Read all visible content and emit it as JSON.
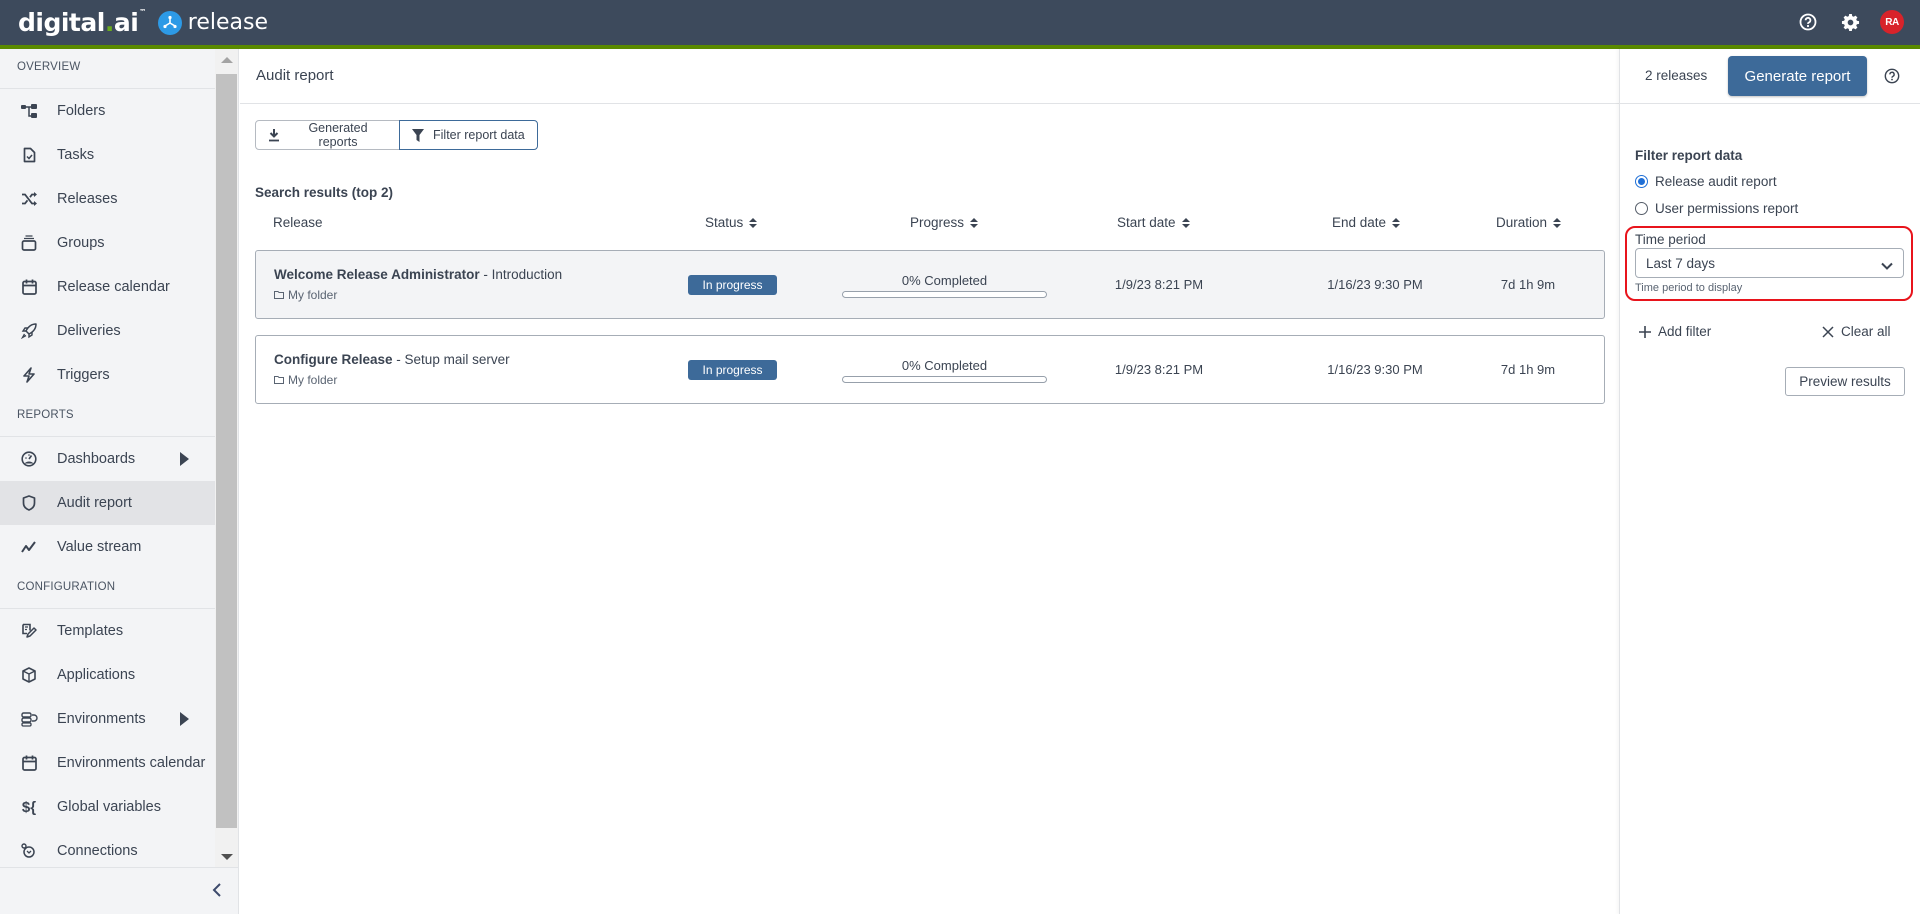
{
  "header": {
    "brand_primary": "digital",
    "brand_dot": ".",
    "brand_suffix": "ai",
    "product": "release",
    "avatar_initials": "RA",
    "icons": [
      "help-icon",
      "gear-icon"
    ],
    "colors": {
      "topbar": "#3d4a5c",
      "accent": "#5a8a00",
      "avatar": "#d8232a"
    }
  },
  "sidebar": {
    "sections": [
      {
        "title": "OVERVIEW",
        "items": [
          {
            "label": "Folders",
            "icon": "folders-icon"
          },
          {
            "label": "Tasks",
            "icon": "tasks-icon"
          },
          {
            "label": "Releases",
            "icon": "releases-icon"
          },
          {
            "label": "Groups",
            "icon": "groups-icon"
          },
          {
            "label": "Release calendar",
            "icon": "calendar-icon"
          },
          {
            "label": "Deliveries",
            "icon": "rocket-icon"
          },
          {
            "label": "Triggers",
            "icon": "lightning-icon"
          }
        ]
      },
      {
        "title": "REPORTS",
        "items": [
          {
            "label": "Dashboards",
            "icon": "dashboard-icon",
            "submenu": true
          },
          {
            "label": "Audit report",
            "icon": "shield-icon",
            "active": true
          },
          {
            "label": "Value stream",
            "icon": "value-stream-icon"
          }
        ]
      },
      {
        "title": "CONFIGURATION",
        "items": [
          {
            "label": "Templates",
            "icon": "templates-icon"
          },
          {
            "label": "Applications",
            "icon": "applications-icon"
          },
          {
            "label": "Environments",
            "icon": "environments-icon",
            "submenu": true
          },
          {
            "label": "Environments calendar",
            "icon": "calendar-icon"
          },
          {
            "label": "Global variables",
            "icon": "variables-icon"
          },
          {
            "label": "Connections",
            "icon": "connections-icon"
          }
        ]
      }
    ]
  },
  "page": {
    "title": "Audit report",
    "release_count": "2 releases",
    "generate_button": "Generate report"
  },
  "toolbar": {
    "generated_reports": "Generated reports",
    "filter_report_data": "Filter report data"
  },
  "results": {
    "title": "Search results (top 2)",
    "columns": [
      "Release",
      "Status",
      "Progress",
      "Start date",
      "End date",
      "Duration"
    ],
    "rows": [
      {
        "name": "Welcome Release Administrator",
        "phase": " - Introduction",
        "folder": "My folder",
        "status": "In progress",
        "progress_label": "0% Completed",
        "progress_percent": 0,
        "start": "1/9/23 8:21 PM",
        "end": "1/16/23 9:30 PM",
        "duration": "7d 1h 9m"
      },
      {
        "name": "Configure Release",
        "phase": " - Setup mail server",
        "folder": "My folder",
        "status": "In progress",
        "progress_label": "0% Completed",
        "progress_percent": 0,
        "start": "1/9/23 8:21 PM",
        "end": "1/16/23 9:30 PM",
        "duration": "7d 1h 9m"
      }
    ]
  },
  "filter_panel": {
    "title": "Filter report data",
    "report_types": [
      {
        "label": "Release audit report",
        "selected": true
      },
      {
        "label": "User permissions report",
        "selected": false
      }
    ],
    "time_period_label": "Time period",
    "time_period_value": "Last 7 days",
    "time_period_help": "Time period to display",
    "add_filter": "Add filter",
    "clear_all": "Clear all",
    "preview_results": "Preview results"
  }
}
